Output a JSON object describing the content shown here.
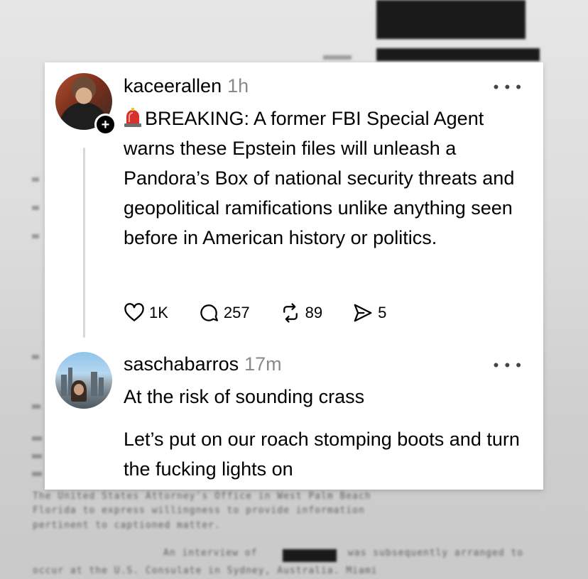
{
  "background": {
    "lines": [
      "The United States Attorney's Office in West Palm Beach",
      "Florida to express willingness to provide information",
      "pertinent to captioned matter.",
      "An interview of",
      "was subsequently arranged to",
      "occur at the U.S. Consulate in Sydney, Australia. Miami"
    ]
  },
  "posts": [
    {
      "username": "kaceerallen",
      "time": "1h",
      "more_icon": "more-horizontal-icon",
      "text": "BREAKING: A former FBI Special Agent warns these Epstein files will unleash a Pandora’s Box of national security threats and geopolitical ramifications unlike anything seen before in American history or politics.",
      "emoji": "rotating-light-icon",
      "follow_badge": "+",
      "actions": {
        "likes": "1K",
        "replies": "257",
        "reposts": "89",
        "shares": "5"
      }
    },
    {
      "username": "saschabarros",
      "time": "17m",
      "more_icon": "more-horizontal-icon",
      "paragraphs": [
        "At the risk of sounding crass",
        "Let’s put on our roach stomping boots and turn the fucking lights on"
      ]
    }
  ],
  "colors": {
    "text": "#000000",
    "muted": "#8a8a8a",
    "thread_line": "#d8d8d8",
    "siren_red": "#d9302b"
  }
}
